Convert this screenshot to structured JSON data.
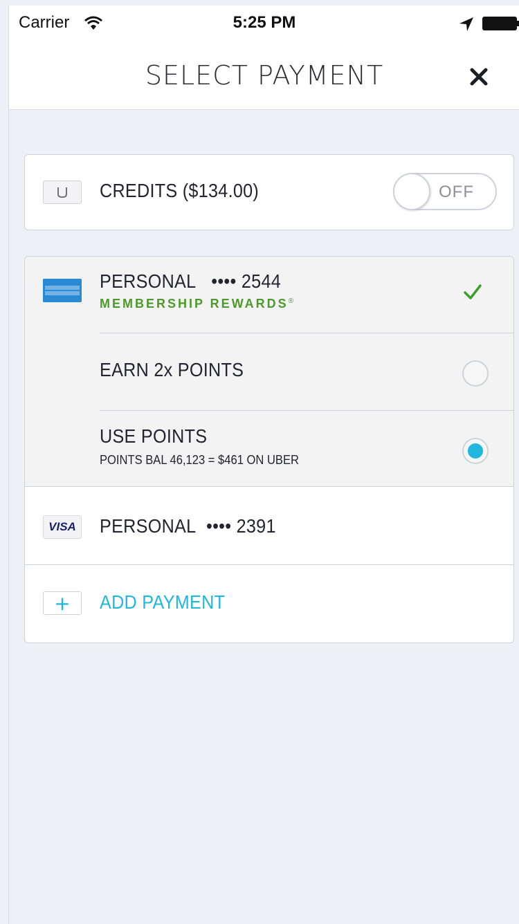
{
  "status_bar": {
    "carrier": "Carrier",
    "time": "5:25 PM",
    "icons": [
      "wifi-icon",
      "location-arrow-icon",
      "battery-icon"
    ]
  },
  "header": {
    "title": "SELECT PAYMENT",
    "close_icon": "close-icon"
  },
  "credits": {
    "icon": "uber-credit-icon",
    "label": "CREDITS ($134.00)",
    "toggle_label": "OFF",
    "toggle_on": false
  },
  "payment_methods": {
    "amex": {
      "icon": "american-express-icon",
      "label": "PERSONAL",
      "masked_number": "•••• 2544",
      "program": "MEMBERSHIP REWARDS",
      "program_mark": "®",
      "selected": true,
      "options": [
        {
          "label": "EARN 2x POINTS",
          "selected": false
        },
        {
          "label": "USE POINTS",
          "sublabel": "POINTS BAL 46,123 = $461 ON UBER",
          "selected": true
        }
      ]
    },
    "visa": {
      "icon": "visa-icon",
      "brand": "VISA",
      "label": "PERSONAL",
      "masked_number": "•••• 2391"
    },
    "add_payment": {
      "icon": "plus-icon",
      "label": "ADD PAYMENT"
    }
  },
  "colors": {
    "accent": "#1fb7e0",
    "rewards_green": "#4c9a2a",
    "check_green": "#3aa12a",
    "amex_blue": "#2a8ad4",
    "visa_blue": "#1a1f71"
  }
}
